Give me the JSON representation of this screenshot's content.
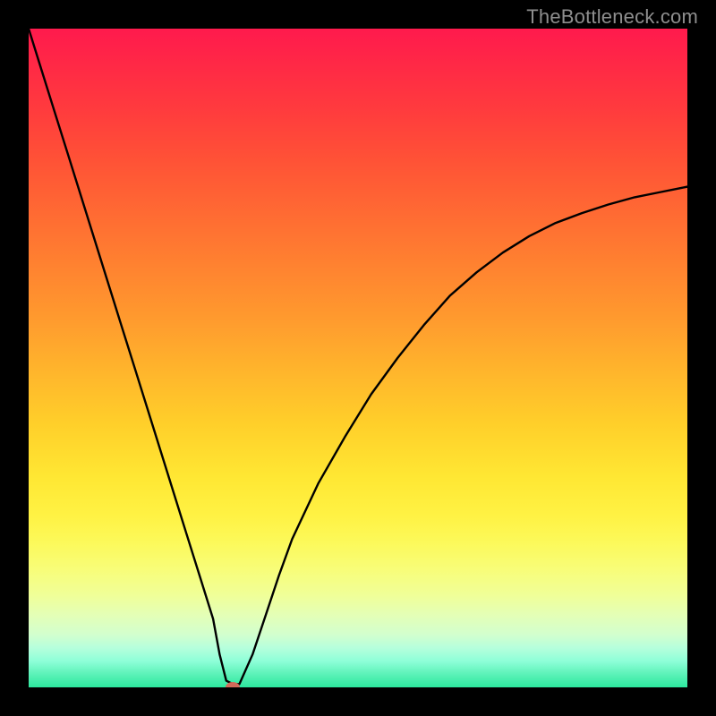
{
  "watermark": "TheBottleneck.com",
  "chart_data": {
    "type": "line",
    "title": "",
    "xlabel": "",
    "ylabel": "",
    "xlim": [
      0,
      100
    ],
    "ylim": [
      0,
      100
    ],
    "x": [
      0,
      2,
      4,
      6,
      8,
      10,
      12,
      14,
      16,
      18,
      20,
      22,
      24,
      26,
      28,
      29,
      30,
      31,
      32,
      34,
      36,
      38,
      40,
      44,
      48,
      52,
      56,
      60,
      64,
      68,
      72,
      76,
      80,
      84,
      88,
      92,
      96,
      100
    ],
    "values": [
      100,
      93.6,
      87.2,
      80.8,
      74.4,
      68.0,
      61.6,
      55.2,
      48.8,
      42.4,
      36.0,
      29.6,
      23.2,
      16.8,
      10.4,
      5.0,
      1.0,
      0.5,
      0.5,
      5.0,
      11.0,
      17.0,
      22.5,
      31.0,
      38.0,
      44.5,
      50.0,
      55.0,
      59.5,
      63.0,
      66.0,
      68.5,
      70.5,
      72.0,
      73.3,
      74.4,
      75.2,
      76.0
    ],
    "marker": {
      "x": 31,
      "y": 0,
      "color": "#d26a5a"
    },
    "background_gradient": {
      "top": "#ff1a4d",
      "mid": "#ffe733",
      "bottom": "#2ce89e"
    }
  }
}
